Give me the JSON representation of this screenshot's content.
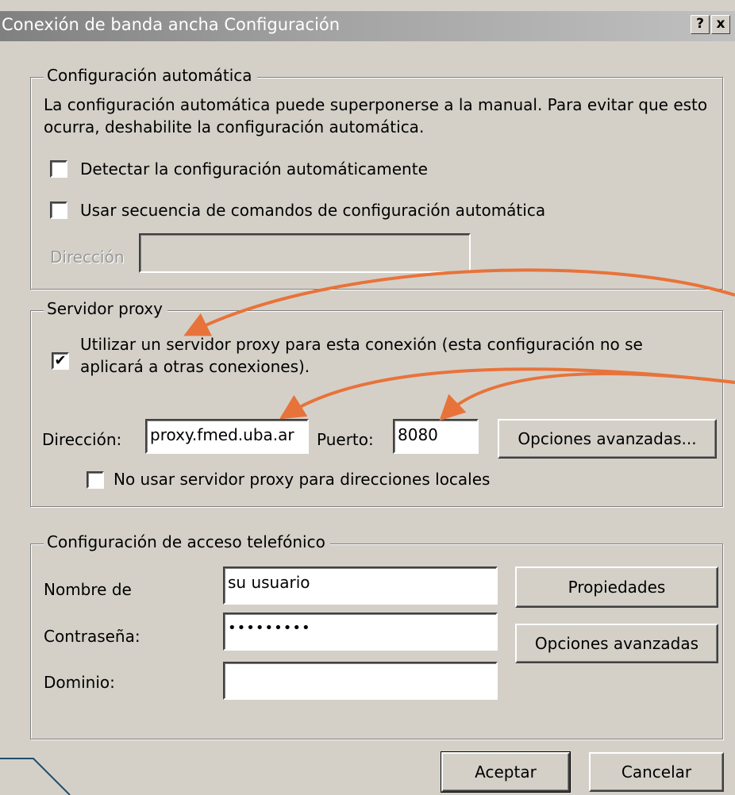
{
  "window": {
    "title": "Conexión de banda ancha Configuración",
    "help_glyph": "?",
    "close_glyph": "x"
  },
  "auto_config": {
    "legend": "Configuración automática",
    "description": "La configuración automática puede superponerse a la manual. Para evitar que esto ocurra, deshabilite la configuración automática.",
    "detect_label": "Detectar la configuración automáticamente",
    "detect_checked": false,
    "script_label": "Usar secuencia de comandos de configuración automática",
    "script_checked": false,
    "address_label": "Dirección",
    "address_value": ""
  },
  "proxy": {
    "legend": "Servidor proxy",
    "use_proxy_label": "Utilizar un servidor proxy para esta conexión (esta configuración no se aplicará a otras conexiones).",
    "use_proxy_checked": true,
    "address_label": "Dirección:",
    "address_value": "proxy.fmed.uba.ar",
    "port_label": "Puerto:",
    "port_value": "8080",
    "advanced_button": "Opciones avanzadas...",
    "bypass_local_label": "No usar servidor proxy para direcciones locales",
    "bypass_local_checked": false
  },
  "dialup": {
    "legend": "Configuración de acceso telefónico",
    "username_label": "Nombre de",
    "username_value": "su usuario",
    "password_label": "Contraseña:",
    "password_value": "•••••••••",
    "domain_label": "Dominio:",
    "domain_value": "",
    "properties_button": "Propiedades",
    "advanced_button": "Opciones avanzadas"
  },
  "footer": {
    "ok_button": "Aceptar",
    "cancel_button": "Cancelar"
  },
  "colors": {
    "dialog_bg": "#d4d0c8",
    "annotation_arrow": "#e8733a",
    "annotation_line": "#1d4e6e"
  },
  "check_glyph": "✔"
}
